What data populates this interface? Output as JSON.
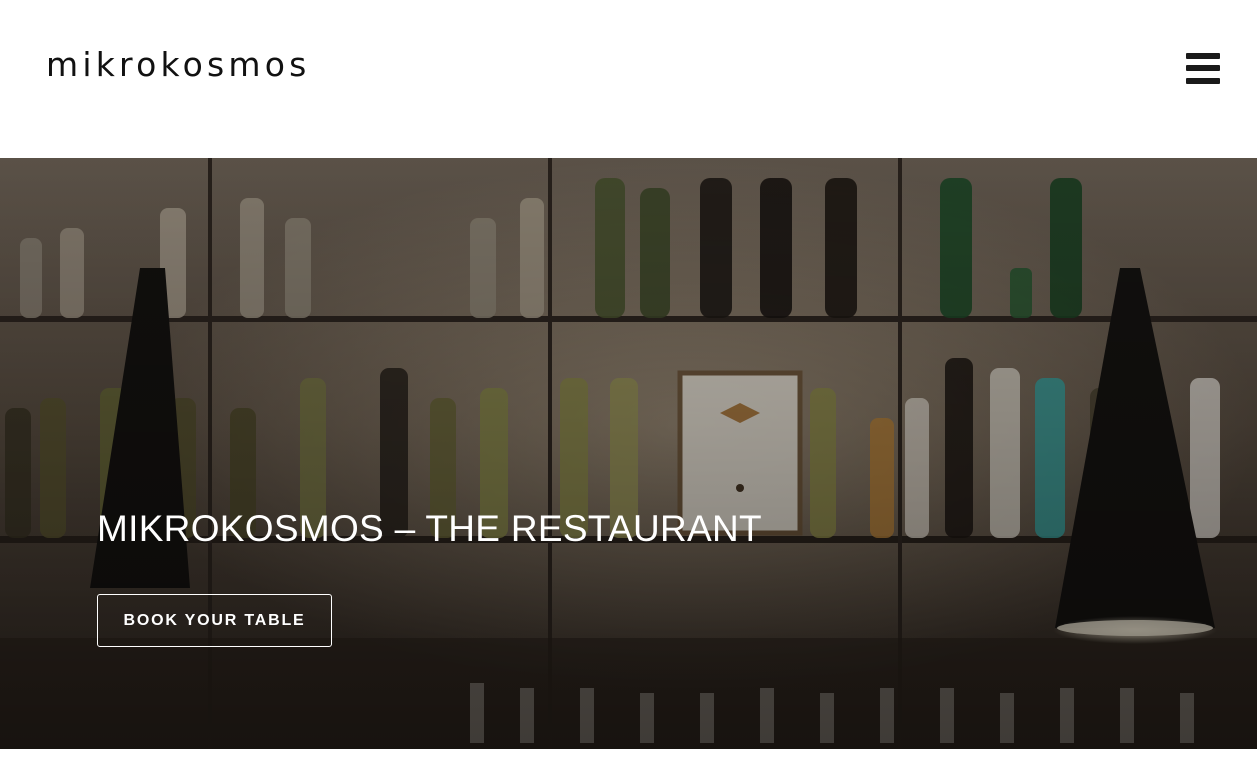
{
  "header": {
    "logo_text": "mikrokosmos",
    "menu_icon": "hamburger-menu-icon"
  },
  "hero": {
    "title": "MIKROKOSMOS – THE RESTAURANT",
    "cta_label": "BOOK YOUR TABLE",
    "background_image": "wine-bar-shelves-photo"
  },
  "colors": {
    "header_bg": "#ffffff",
    "logo": "#111111",
    "hero_text": "#ffffff"
  }
}
